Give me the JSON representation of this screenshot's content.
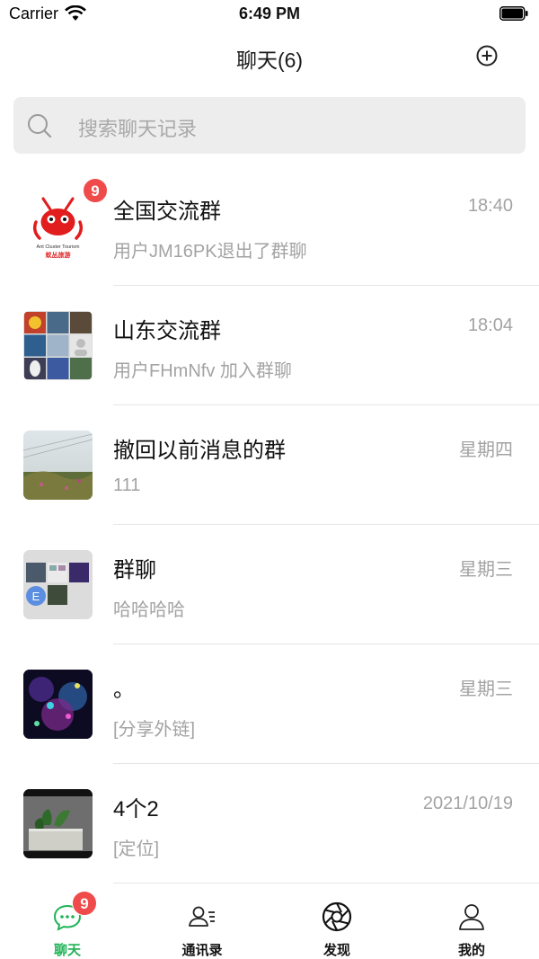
{
  "status": {
    "carrier": "Carrier",
    "time": "6:49 PM"
  },
  "nav": {
    "title": "聊天(6)"
  },
  "search": {
    "placeholder": "搜索聊天记录"
  },
  "chats": [
    {
      "name": "全国交流群",
      "time": "18:40",
      "preview": "用户JM16PK退出了群聊",
      "badge": "9",
      "avatar_text_1": "Ant Cluster Tourism",
      "avatar_text_2": "蚁丛旅游"
    },
    {
      "name": "山东交流群",
      "time": "18:04",
      "preview": "用户FHmNfv 加入群聊"
    },
    {
      "name": "撤回以前消息的群",
      "time": "星期四",
      "preview": "111"
    },
    {
      "name": "群聊",
      "time": "星期三",
      "preview": "哈哈哈哈",
      "avatar_letter": "E"
    },
    {
      "name": "。",
      "time": "星期三",
      "preview": "[分享外链]"
    },
    {
      "name": "4个2",
      "time": "2021/10/19",
      "preview": "[定位]"
    }
  ],
  "tabs": [
    {
      "label": "聊天",
      "icon": "chat-bubble-icon",
      "badge": "9",
      "active": true
    },
    {
      "label": "通讯录",
      "icon": "contacts-icon"
    },
    {
      "label": "发现",
      "icon": "aperture-icon"
    },
    {
      "label": "我的",
      "icon": "person-icon"
    }
  ],
  "colors": {
    "accent": "#1fb355",
    "badge": "#f04b4b",
    "secondary_text": "#a3a3a3",
    "search_bg": "#ededed"
  }
}
